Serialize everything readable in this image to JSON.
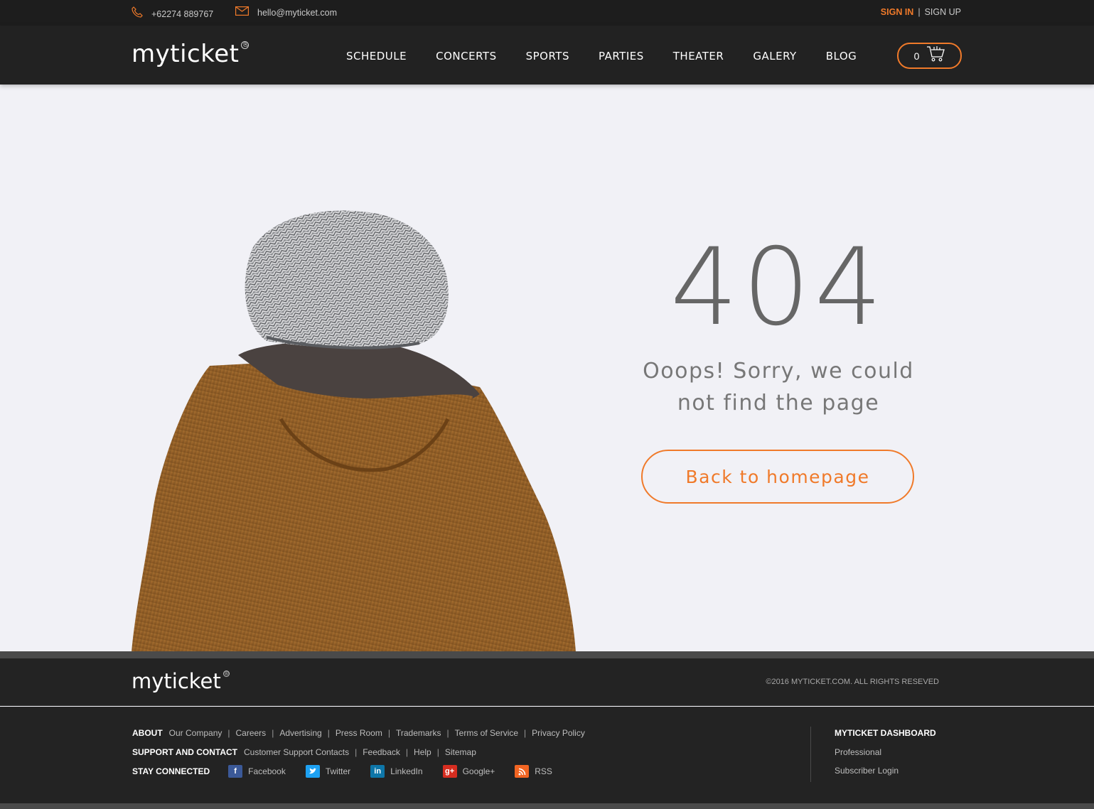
{
  "topbar": {
    "phone": "+62274 889767",
    "email": "hello@myticket.com",
    "sign_in": "SIGN IN",
    "divider": "|",
    "sign_up": "SIGN UP"
  },
  "nav": {
    "logo": "myticket",
    "logo_mark": "®",
    "links": [
      "SCHEDULE",
      "CONCERTS",
      "SPORTS",
      "PARTIES",
      "THEATER",
      "GALERY",
      "BLOG"
    ],
    "cart_count": "0"
  },
  "error": {
    "code": "404",
    "message": "Ooops! Sorry, we could not find the page",
    "button": "Back to homepage"
  },
  "footer": {
    "logo": "myticket",
    "logo_mark": "®",
    "copyright": "©2016 MYTICKET.COM. ALL RIGHTS RESEVED",
    "about": {
      "heading": "ABOUT",
      "links": [
        "Our Company",
        "Careers",
        "Advertising",
        "Press Room",
        "Trademarks",
        "Terms of Service",
        "Privacy Policy"
      ]
    },
    "support": {
      "heading": "SUPPORT AND CONTACT",
      "links": [
        "Customer Support Contacts",
        "Feedback",
        "Help",
        "Sitemap"
      ]
    },
    "connect": {
      "heading": "STAY CONNECTED",
      "links": [
        {
          "label": "Facebook",
          "icon": "facebook-icon",
          "color": "#3b5998"
        },
        {
          "label": "Twitter",
          "icon": "twitter-icon",
          "color": "#1da1f2"
        },
        {
          "label": "LinkedIn",
          "icon": "linkedin-icon",
          "color": "#0e76a8"
        },
        {
          "label": "Google+",
          "icon": "google-plus-icon",
          "color": "#d62d20"
        },
        {
          "label": "RSS",
          "icon": "rss-icon",
          "color": "#f26522"
        }
      ]
    },
    "dashboard": {
      "heading": "MYTICKET DASHBOARD",
      "links": [
        "Professional",
        "Subscriber Login"
      ]
    }
  },
  "colors": {
    "accent": "#f07a2a",
    "nav_bg": "#222222",
    "page_bg": "#f1f1f6"
  }
}
